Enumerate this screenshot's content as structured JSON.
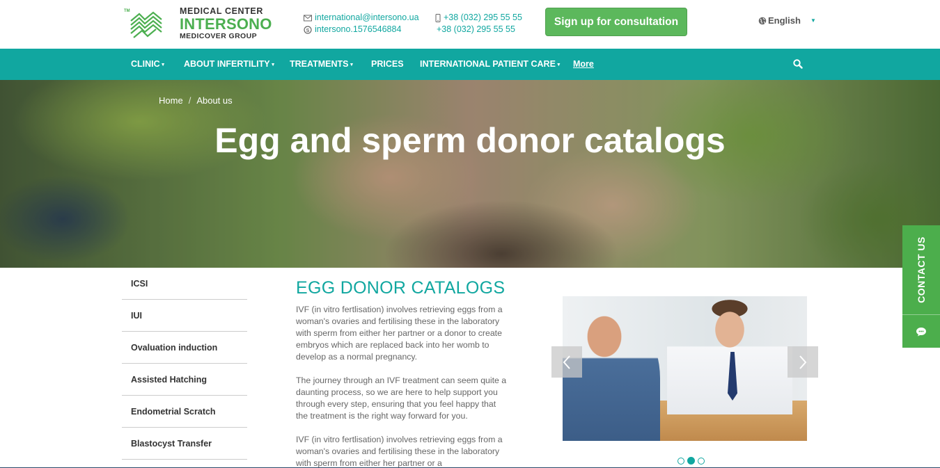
{
  "header": {
    "logo": {
      "line1": "MEDICAL CENTER",
      "line2": "INTERSONO",
      "line3": "MEDICOVER GROUP",
      "tm": "TM"
    },
    "email": "international@intersono.ua",
    "skype": "intersono.1576546884",
    "phone1": "+38 (032) 295 55 55",
    "phone2": "+38 (032) 295 55 55",
    "signup_label": "Sign up for consultation",
    "language": "English",
    "icons": {
      "email": "envelope-icon",
      "skype": "skype-icon",
      "phone": "mobile-phone-icon",
      "globe": "globe-icon"
    }
  },
  "nav": {
    "items": [
      {
        "label": "CLINIC",
        "dropdown": true
      },
      {
        "label": "ABOUT INFERTILITY",
        "dropdown": true
      },
      {
        "label": "TREATMENTS",
        "dropdown": true
      },
      {
        "label": "PRICES",
        "dropdown": false
      },
      {
        "label": "INTERNATIONAL PATIENT CARE",
        "dropdown": true
      },
      {
        "label": "More",
        "dropdown": false
      }
    ],
    "search_icon": "search-icon"
  },
  "hero": {
    "breadcrumb": [
      "Home",
      "About us"
    ],
    "breadcrumb_sep": "/",
    "title": "Egg and sperm donor catalogs"
  },
  "sidebar": {
    "items": [
      {
        "label": "ICSI"
      },
      {
        "label": "IUI"
      },
      {
        "label": "Ovaluation induction"
      },
      {
        "label": "Assisted Hatching"
      },
      {
        "label": "Endometrial Scratch"
      },
      {
        "label": "Blastocyst Transfer"
      }
    ]
  },
  "main": {
    "title": "EGG DONOR CATALOGS",
    "paragraphs": [
      "IVF (in vitro fertlisation) involves retrieving eggs from a woman's ovaries and fertilising these in the laboratory with sperm from either her partner or a donor to create embryos which are replaced back into her womb to develop as a normal pregnancy.",
      "The journey through an IVF treatment can seem quite a daunting process, so we are here to help support you through every step, ensuring that you feel happy that the treatment is the right way forward for you.",
      "IVF (in vitro fertlisation) involves retrieving eggs from a woman's ovaries and fertilising these in the laboratory with sperm from either her partner or a"
    ]
  },
  "carousel": {
    "slide_count": 3,
    "active_index": 1
  },
  "contact_tab": {
    "label": "CONTACT US",
    "icon": "chat-bubble-icon"
  },
  "colors": {
    "accent": "#11a7a0",
    "green": "#5cb85c",
    "text": "#666666"
  }
}
